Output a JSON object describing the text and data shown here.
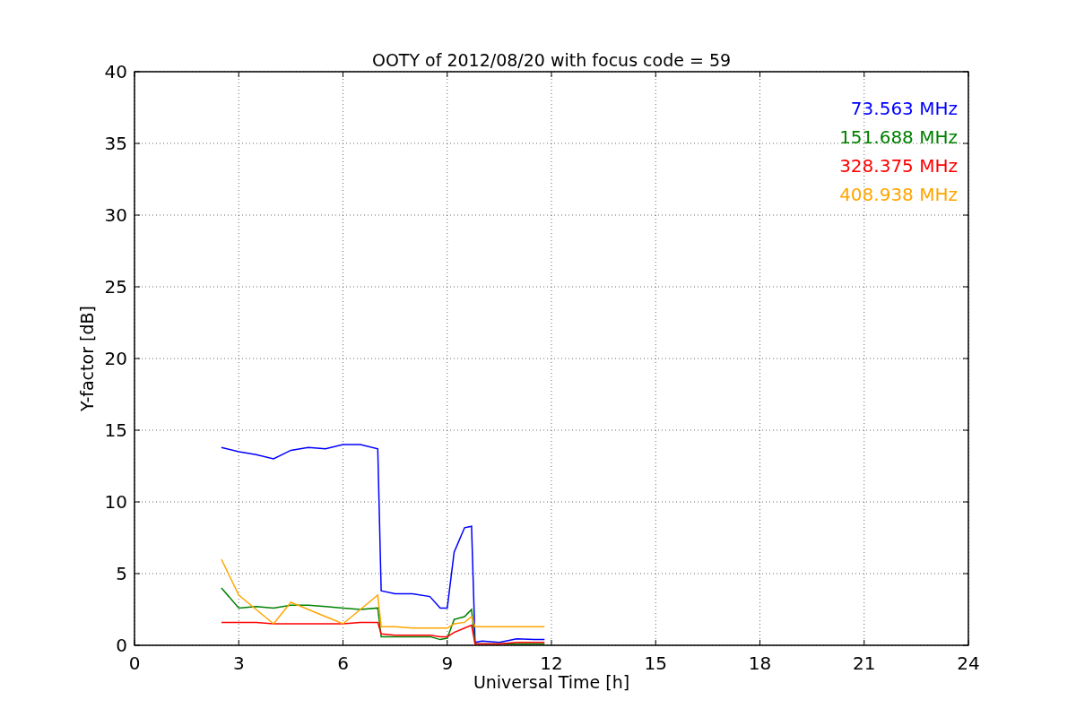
{
  "chart_data": {
    "type": "line",
    "title": "OOTY of 2012/08/20 with focus code = 59",
    "xlabel": "Universal Time [h]",
    "ylabel": "Y-factor [dB]",
    "x": [
      2.5,
      3,
      3.5,
      4,
      4.5,
      5,
      5.5,
      6,
      6.5,
      7,
      7.1,
      7.5,
      8,
      8.5,
      8.8,
      9,
      9.2,
      9.5,
      9.7,
      9.8,
      10,
      10.5,
      11,
      11.5,
      11.8
    ],
    "series": [
      {
        "name": "73.563 MHz",
        "color": "#0000ff",
        "values": [
          13.8,
          13.5,
          13.3,
          13.0,
          13.6,
          13.8,
          13.7,
          14.0,
          14.0,
          13.7,
          3.8,
          3.6,
          3.6,
          3.4,
          2.6,
          2.6,
          6.5,
          8.2,
          8.3,
          0.2,
          0.3,
          0.2,
          0.45,
          0.4,
          0.4
        ]
      },
      {
        "name": "151.688 MHz",
        "color": "#008000",
        "values": [
          4.0,
          2.6,
          2.7,
          2.6,
          2.8,
          2.8,
          2.7,
          2.6,
          2.5,
          2.6,
          0.6,
          0.6,
          0.6,
          0.6,
          0.4,
          0.5,
          1.8,
          2.0,
          2.5,
          0.1,
          0.1,
          0.1,
          0.1,
          0.1,
          0.1
        ]
      },
      {
        "name": "328.375 MHz",
        "color": "#ff0000",
        "values": [
          1.6,
          1.6,
          1.6,
          1.5,
          1.5,
          1.5,
          1.5,
          1.5,
          1.6,
          1.6,
          0.8,
          0.7,
          0.7,
          0.7,
          0.6,
          0.6,
          0.9,
          1.2,
          1.4,
          0.1,
          0.1,
          0.1,
          0.2,
          0.2,
          0.2
        ]
      },
      {
        "name": "408.938 MHz",
        "color": "#ffa500",
        "values": [
          6.0,
          3.5,
          2.5,
          1.5,
          3.0,
          2.5,
          2.0,
          1.5,
          2.5,
          3.5,
          1.3,
          1.3,
          1.2,
          1.2,
          1.2,
          1.2,
          1.5,
          1.6,
          2.0,
          1.3,
          1.3,
          1.3,
          1.3,
          1.3,
          1.3
        ]
      }
    ],
    "xlim": [
      0,
      24
    ],
    "ylim": [
      0,
      40
    ],
    "grid": true,
    "xticks": [
      0,
      3,
      6,
      9,
      12,
      15,
      18,
      21,
      24
    ],
    "yticks": [
      0,
      5,
      10,
      15,
      20,
      25,
      30,
      35,
      40
    ]
  }
}
